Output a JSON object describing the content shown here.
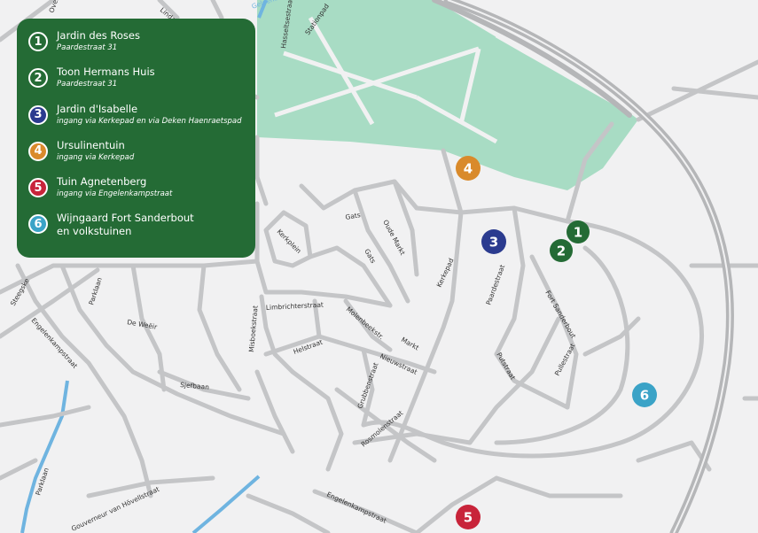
{
  "colors": {
    "background": "#f1f1f2",
    "park": "#a8dcc4",
    "road": "#c4c5c7",
    "ring_road": "#b5b6b8",
    "water": "#6fb4e0",
    "legend_bg": "#246b35"
  },
  "legend": {
    "items": [
      {
        "number": "1",
        "name": "Jardin des Roses",
        "sub": "Paardestraat 31",
        "color": "#246b35"
      },
      {
        "number": "2",
        "name": "Toon Hermans Huis",
        "sub": "Paardestraat 31",
        "color": "#246b35"
      },
      {
        "number": "3",
        "name": "Jardin d'Isabelle",
        "sub": "ingang via Kerkepad en via Deken Haenraetspad",
        "color": "#2b3b8f"
      },
      {
        "number": "4",
        "name": "Ursulinentuin",
        "sub": "ingang via Kerkepad",
        "color": "#d98a2b"
      },
      {
        "number": "5",
        "name": "Tuin Agnetenberg",
        "sub": "ingang via Engelenkampstraat",
        "color": "#c8243a"
      },
      {
        "number": "6",
        "name": "Wijngaard Fort Sanderbout",
        "sub": "en volkstuinen",
        "color": "#3ba3c7"
      }
    ]
  },
  "markers": [
    {
      "number": "1",
      "color": "#246b35"
    },
    {
      "number": "2",
      "color": "#246b35"
    },
    {
      "number": "3",
      "color": "#2b3b8f"
    },
    {
      "number": "4",
      "color": "#d98a2b"
    },
    {
      "number": "5",
      "color": "#c8243a"
    },
    {
      "number": "6",
      "color": "#3ba3c7"
    }
  ],
  "streets": {
    "hasseltsestraat": "Hasseltsestraat",
    "stationpad": "Stationpad",
    "kerkplein": "Kerkplein",
    "gats1": "Gats",
    "gats2": "Gats",
    "oude_markt": "Oude Markt",
    "kerkepad": "Kerkepad",
    "paardestraat": "Paardestraat",
    "fort_sanderbout": "Fort Sanderbout",
    "limbrichterstraat": "Limbrichterstraat",
    "misboekstraat": "Misboekstraat",
    "molenbeekstr": "Molenbeekstr.",
    "markt": "Markt",
    "nieuwstraat": "Nieuwstraat",
    "helstraat": "Helstraat",
    "de_wever": "De Weëir",
    "parklaan1": "Parklaan",
    "parklaan2": "Parklaan",
    "steegske": "Steegske",
    "engelenkampstraat1": "Engelenkampstraat",
    "engelenkampstraat2": "Engelenkampstraat",
    "sjefbaan": "Sjefbaan",
    "putstraat": "Putstraat",
    "pullestraat": "Pullestraat",
    "grubbenstraat": "Grubbenstraat",
    "rosmolenstraat": "Rosmolenstraat",
    "gouverneur": "Gouverneur van Hövellstraat",
    "lindanusstraat": "Lindanusstraat",
    "overhovenerstraat": "Overhovenerstraat",
    "geleenbeek": "Geleenbeek"
  }
}
